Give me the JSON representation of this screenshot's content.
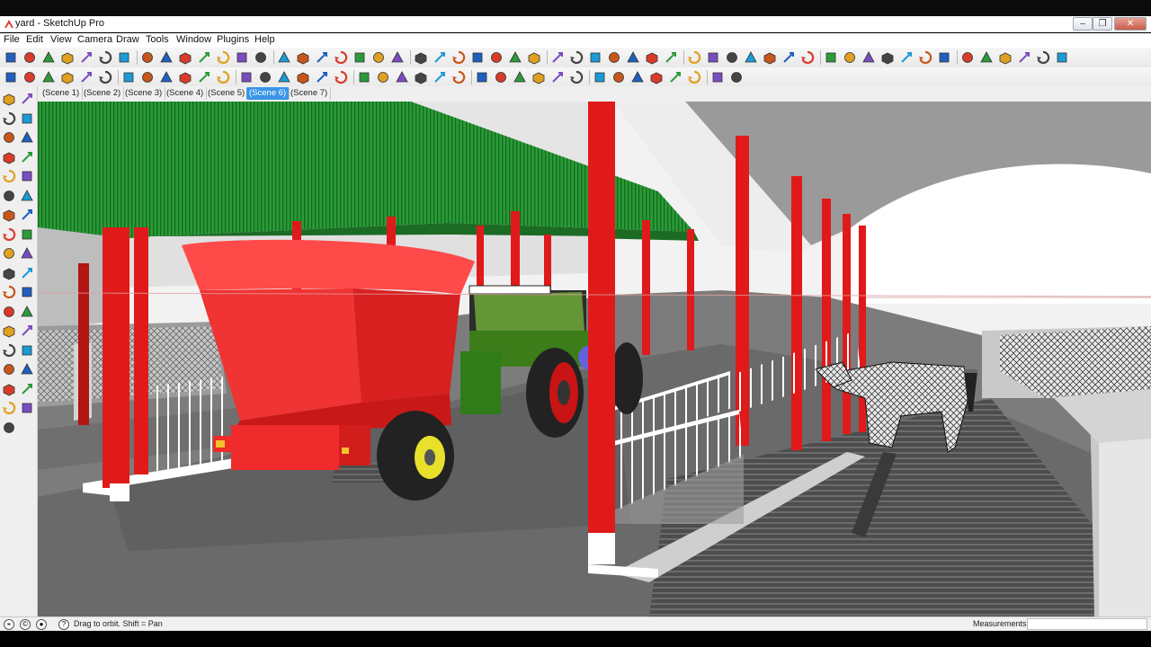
{
  "window": {
    "title": "yard - SketchUp Pro",
    "controls": {
      "minimize": "–",
      "maximize": "❐",
      "close": "✕"
    }
  },
  "menu": [
    "File",
    "Edit",
    "View",
    "Camera",
    "Draw",
    "Tools",
    "Window",
    "Plugins",
    "Help"
  ],
  "toolbar_row1_icons": [
    "select-icon",
    "line-icon",
    "rectangle-icon",
    "circle-icon",
    "arc-icon",
    "eraser-icon",
    "paint-bucket-icon",
    "push-pull-icon",
    "move-icon",
    "rotate-icon",
    "follow-me-icon",
    "offset-icon",
    "orbit-icon",
    "pan-icon",
    "zoom-icon",
    "zoom-extents-icon",
    "tape-measure-icon",
    "dimension-icon",
    "protractor-icon",
    "text-icon",
    "axes-icon",
    "3d-text-icon",
    "iso-view-icon",
    "top-view-icon",
    "front-view-icon",
    "right-view-icon",
    "back-view-icon",
    "left-view-icon",
    "orbit-2-icon",
    "pan-2-icon",
    "zoom-2-icon",
    "zoom-window-icon",
    "previous-view-icon",
    "next-view-icon",
    "zoom-extents-2-icon",
    "xray-icon",
    "back-edges-icon",
    "wireframe-icon",
    "hidden-line-icon",
    "shaded-icon",
    "shaded-textures-icon",
    "monochrome-icon",
    "section-plane-icon",
    "display-section-icon",
    "section-cut-icon",
    "solid-union-icon",
    "solid-subtract-icon",
    "sandbox-icon",
    "play-icon",
    "stop-icon",
    "shadow-icon",
    "fog-icon",
    "grid-icon",
    "warehouse-icon",
    "components-icon"
  ],
  "toolbar_row2_icons": [
    "play-scene-icon",
    "previous-scene-icon",
    "pause-icon",
    "paint-icon",
    "back-icon",
    "extrude-icon",
    "cylinder-icon",
    "cone-icon",
    "pyramid-icon",
    "sphere-icon",
    "torus-icon",
    "bevel-icon",
    "bend-icon",
    "rotate-3d-icon",
    "mirror-icon",
    "refresh-icon",
    "flip-icon",
    "pin-icon",
    "ball-icon",
    "dynamic-icon",
    "link-icon",
    "tools-icon",
    "cut-icon",
    "box-icon",
    "box-open-icon",
    "box-wire-icon",
    "box-side-icon",
    "box-dark-icon",
    "box-blue-icon",
    "plant-icon",
    "layers-icon",
    "tree-icon",
    "align-icon",
    "measure-icon",
    "fire-icon",
    "snap-icon",
    "rope-icon",
    "attach-icon"
  ],
  "scenes": [
    "(Scene 1)",
    "(Scene 2)",
    "(Scene 3)",
    "(Scene 4)",
    "(Scene 5)",
    "(Scene 6)",
    "(Scene 7)"
  ],
  "active_scene": "(Scene 6)",
  "left_tools": [
    "select-icon",
    "component-icon",
    "paint-bucket-icon",
    "eraser-icon",
    "rectangle-icon",
    "line-icon",
    "circle-icon",
    "arc-icon",
    "polygon-icon",
    "freehand-icon",
    "move-icon",
    "push-pull-icon",
    "rotate-icon",
    "follow-me-icon",
    "scale-icon",
    "offset-icon",
    "tape-measure-icon",
    "dimension-icon",
    "protractor-icon",
    "text-icon",
    "axes-icon",
    "3d-text-icon",
    "orbit-icon",
    "pan-icon",
    "zoom-icon",
    "zoom-window-icon",
    "previous-view-icon",
    "zoom-extents-icon",
    "position-camera-icon",
    "look-around-icon",
    "walk-icon",
    "section-plane-icon",
    "add-location-icon",
    "terrain-icon",
    "photo-texture-icon"
  ],
  "status": {
    "hint": "Drag to orbit.  Shift = Pan",
    "measurements_label": "Measurements",
    "measurements_value": ""
  },
  "colors": {
    "roof_green": "#1f8a2c",
    "column_red": "#e01a1a",
    "mixer_red": "#f23a3a",
    "tractor_green": "#4d8f1d",
    "floor_gray": "#5c5c5c",
    "active_scene_blue": "#3a95e8"
  }
}
